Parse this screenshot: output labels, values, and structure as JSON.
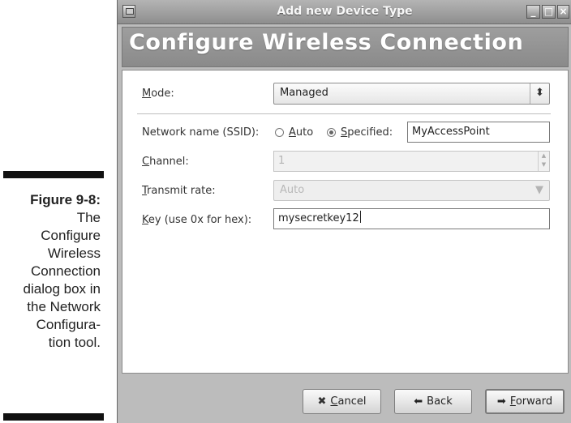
{
  "caption": {
    "label": "Figure 9-8:",
    "line1": "The",
    "line2": "Configure",
    "line3": "Wireless",
    "line4": "Connection",
    "line5": "dialog box in",
    "line6": "the Network",
    "line7": "Configura-",
    "line8": "tion tool."
  },
  "window": {
    "title": "Add new Device Type",
    "controls": {
      "minimize": "_",
      "maximize": "□",
      "close": "×"
    }
  },
  "header": {
    "title": "Configure Wireless Connection"
  },
  "form": {
    "mode": {
      "label_u": "M",
      "label_rest": "ode:",
      "value": "Managed",
      "arrow": "⬍"
    },
    "ssid": {
      "label": "Network name (SSID):",
      "auto_u": "A",
      "auto_rest": "uto",
      "specified_u": "S",
      "specified_rest": "pecified:",
      "selected": "Specified",
      "value": "MyAccessPoint"
    },
    "channel": {
      "label_u": "C",
      "label_rest": "hannel:",
      "value": "1"
    },
    "rate": {
      "label_u": "T",
      "label_rest": "ransmit rate:",
      "value": "Auto"
    },
    "key": {
      "label_u": "K",
      "label_rest": "ey (use 0x for hex):",
      "value": "mysecretkey12"
    }
  },
  "buttons": {
    "cancel": {
      "u": "C",
      "rest": "ancel"
    },
    "back": "Back",
    "forward": {
      "u": "F",
      "rest": "orward"
    }
  }
}
